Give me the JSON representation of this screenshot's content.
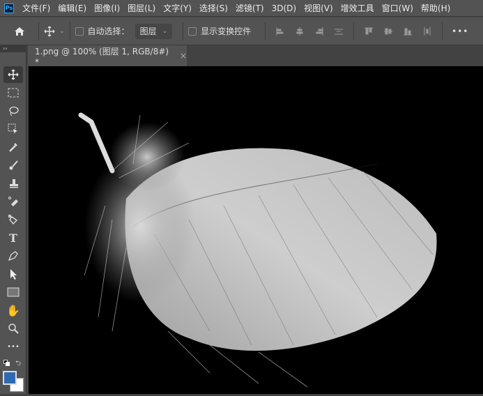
{
  "app": {
    "logo": "Ps"
  },
  "menu": [
    "文件(F)",
    "编辑(E)",
    "图像(I)",
    "图层(L)",
    "文字(Y)",
    "选择(S)",
    "滤镜(T)",
    "3D(D)",
    "视图(V)",
    "增效工具",
    "窗口(W)",
    "帮助(H)"
  ],
  "options": {
    "auto_select_label": "自动选择：",
    "auto_select_value": "图层",
    "show_transform_label": "显示变换控件",
    "more": "•••"
  },
  "document_tab": {
    "title": "1.png @ 100% (图层 1, RGB/8#) *",
    "close": "×"
  },
  "toolbar": {
    "collapse": "››",
    "more": "•••"
  },
  "colors": {
    "foreground": "#2f6ab0",
    "background": "#ffffff",
    "accent": "#31a8ff"
  }
}
